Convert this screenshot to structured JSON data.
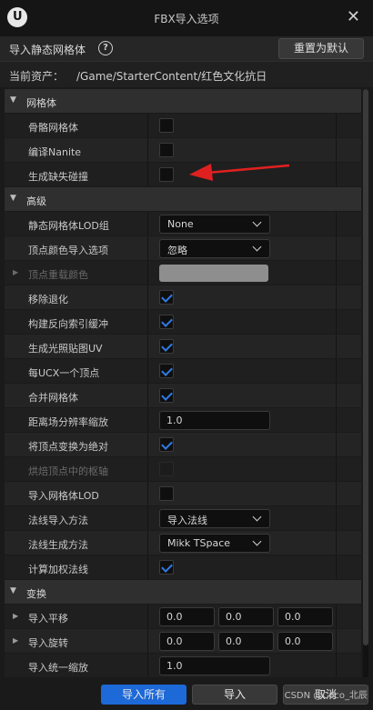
{
  "window": {
    "title": "FBX导入选项",
    "close_glyph": "✕"
  },
  "header": {
    "title": "导入静态网格体",
    "help_glyph": "?",
    "reset_label": "重置为默认"
  },
  "asset": {
    "label": "当前资产：",
    "path": "/Game/StarterContent/红色文化抗日"
  },
  "sections": {
    "mesh": {
      "label": "网格体",
      "skeletal_mesh": {
        "label": "骨骼网格体",
        "checked": false
      },
      "build_nanite": {
        "label": "编译Nanite",
        "checked": false
      },
      "generate_collision": {
        "label": "生成缺失碰撞",
        "checked": false
      }
    },
    "advanced": {
      "label": "高级",
      "lod_group": {
        "label": "静态网格体LOD组",
        "value": "None"
      },
      "vertex_color": {
        "label": "顶点颜色导入选项",
        "value": "忽略"
      },
      "vertex_override_color": {
        "label": "顶点重载颜色",
        "swatch": "#8e8e8e"
      },
      "remove_degenerates": {
        "label": "移除退化",
        "checked": true
      },
      "reversed_index": {
        "label": "构建反向索引缓冲",
        "checked": true
      },
      "lightmap_uv": {
        "label": "生成光照贴图UV",
        "checked": true
      },
      "one_convex_per_ucx": {
        "label": "每UCX一个顶点",
        "checked": true
      },
      "combine_meshes": {
        "label": "合并网格体",
        "checked": true
      },
      "distance_field_scale": {
        "label": "距离场分辨率缩放",
        "value": "1.0"
      },
      "transform_vertex": {
        "label": "将顶点变换为绝对",
        "checked": true
      },
      "bake_pivot": {
        "label": "烘焙顶点中的枢轴",
        "checked": false
      },
      "import_lods": {
        "label": "导入网格体LOD",
        "checked": false
      },
      "normal_import": {
        "label": "法线导入方法",
        "value": "导入法线"
      },
      "normal_generation": {
        "label": "法线生成方法",
        "value": "Mikk TSpace"
      },
      "weighted_normals": {
        "label": "计算加权法线",
        "checked": true
      }
    },
    "transform": {
      "label": "变换",
      "translation": {
        "label": "导入平移",
        "x": "0.0",
        "y": "0.0",
        "z": "0.0"
      },
      "rotation": {
        "label": "导入旋转",
        "x": "0.0",
        "y": "0.0",
        "z": "0.0"
      },
      "uniform_scale": {
        "label": "导入统一缩放",
        "value": "1.0"
      }
    }
  },
  "footer": {
    "import_all": "导入所有",
    "import": "导入",
    "cancel": "取消",
    "watermark": "CSDN @Coco_北辰"
  },
  "colors": {
    "accent": "#1d69d8",
    "check": "#2f7be6",
    "annotation_arrow": "#e02020"
  }
}
